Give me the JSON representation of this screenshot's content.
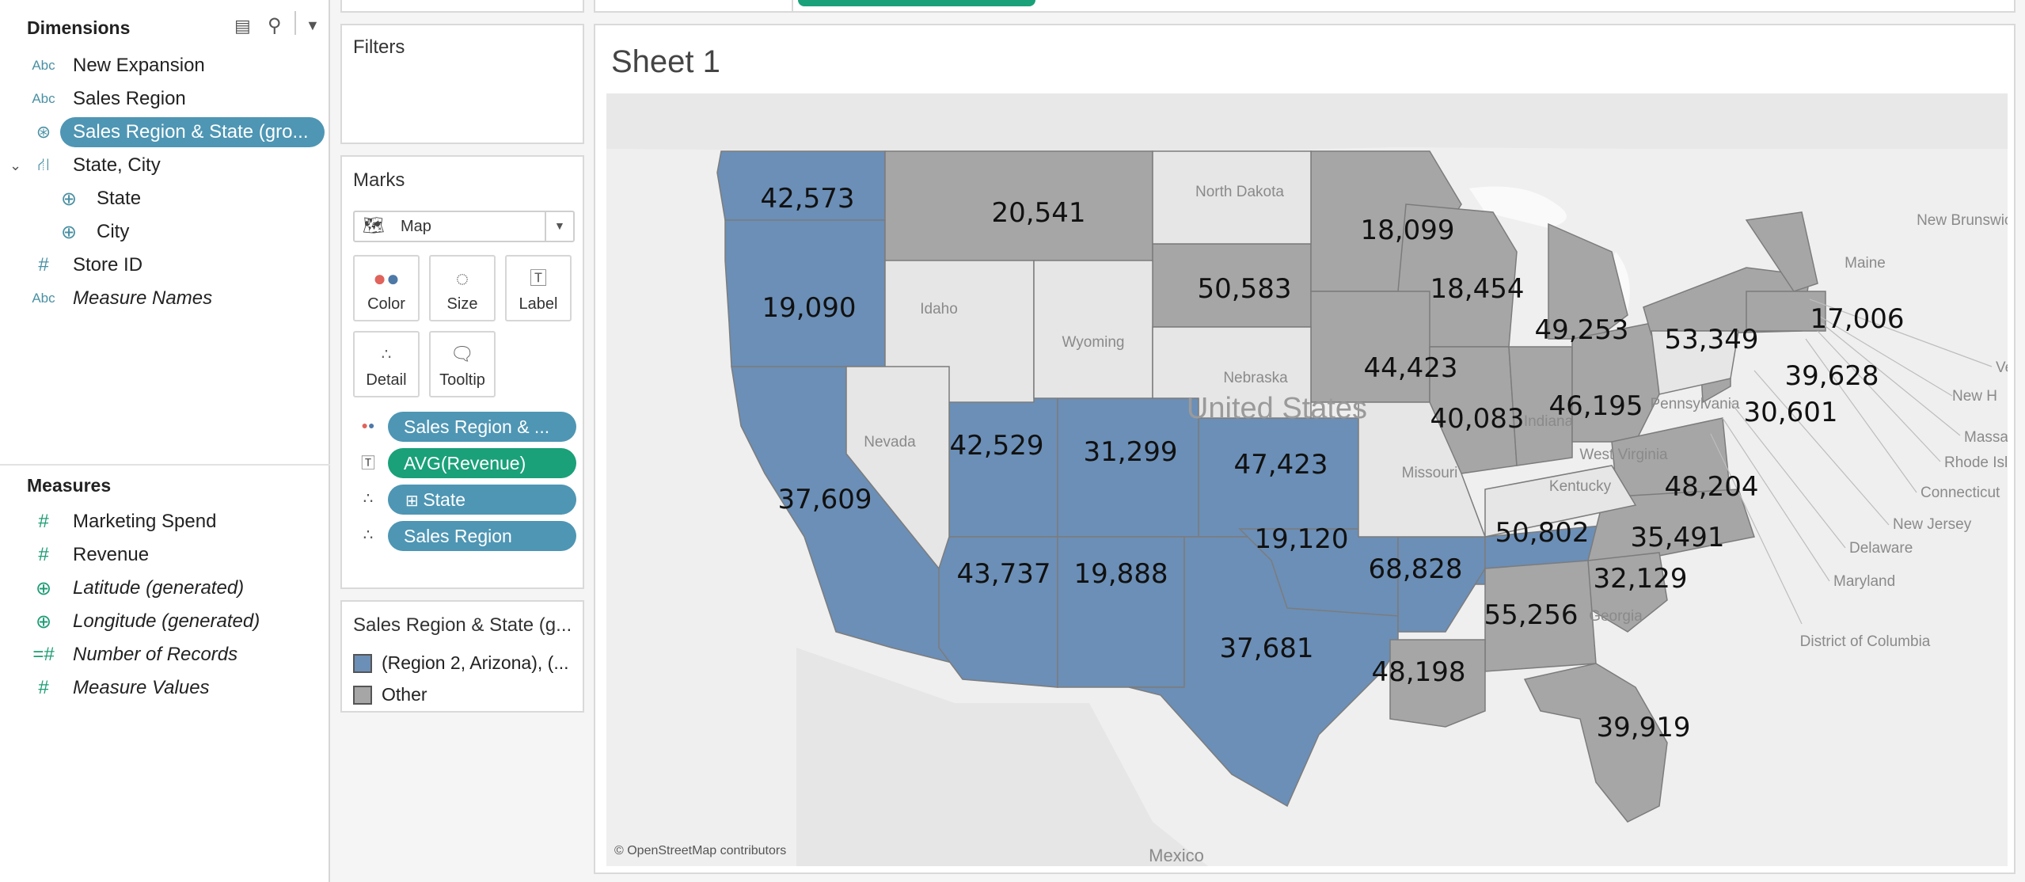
{
  "dimensions": {
    "title": "Dimensions",
    "fields": [
      {
        "icon": "Abc",
        "label": "New Expansion"
      },
      {
        "icon": "Abc",
        "label": "Sales Region"
      },
      {
        "icon": "Abc",
        "label": "Sales Region & State (gro..."
      },
      {
        "icon": "Abc",
        "label": "State, City"
      },
      {
        "icon": "Abc",
        "label": "State"
      },
      {
        "icon": "Abc",
        "label": "City"
      },
      {
        "icon": "Abc",
        "label": "Store ID"
      },
      {
        "icon": "Abc",
        "label": "Measure Names"
      }
    ]
  },
  "measures": {
    "title": "Measures",
    "fields": [
      {
        "label": "Marketing Spend"
      },
      {
        "label": "Revenue"
      },
      {
        "label": "Latitude (generated)"
      },
      {
        "label": "Longitude (generated)"
      },
      {
        "label": "Number of Records"
      },
      {
        "label": "Measure Values"
      }
    ]
  },
  "filters": {
    "title": "Filters"
  },
  "marks": {
    "title": "Marks",
    "type": "Map",
    "buttons": [
      "Color",
      "Size",
      "Label",
      "Detail",
      "Tooltip"
    ],
    "shelf": [
      {
        "label": "Sales Region & ...",
        "color": "#4e96b4"
      },
      {
        "label": "AVG(Revenue)",
        "color": "#1aa179"
      },
      {
        "label": "State",
        "color": "#4e96b4"
      },
      {
        "label": "Sales Region",
        "color": "#4e96b4"
      }
    ]
  },
  "legend": {
    "title": "Sales Region & State (g...",
    "items": [
      {
        "label": "(Region 2, Arizona), (...",
        "color": "#6b8fb7"
      },
      {
        "label": "Other",
        "color": "#a6a6a6"
      }
    ]
  },
  "sheet": {
    "title": "Sheet 1"
  },
  "map": {
    "credit": "© OpenStreetMap contributors",
    "colors": {
      "group": "#6b8fb7",
      "other": "#a6a6a6",
      "none": "#e8e8e8"
    },
    "values": {
      "washington": "42,573",
      "oregon": "19,090",
      "california": "37,609",
      "montana": "20,541",
      "south_dakota": "50,583",
      "minnesota": "18,099",
      "wisconsin": "18,454",
      "michigan": "49,253",
      "iowa": "44,423",
      "illinois": "40,083",
      "ohio": "46,195",
      "new_york": "53,349",
      "vermont_nh": "17,006",
      "massachusetts": "39,628",
      "new_jersey": "30,601",
      "utah": "42,529",
      "colorado": "31,299",
      "kansas": "47,423",
      "arizona": "43,737",
      "new_mexico": "19,888",
      "oklahoma": "19,120",
      "arkansas": "68,828",
      "tennessee": "50,802",
      "virginia": "48,204",
      "north_carolina": "35,491",
      "south_carolina": "32,129",
      "alabama_georgia": "55,256",
      "texas": "37,681",
      "louisiana": "48,198",
      "florida": "39,919"
    },
    "places": {
      "north_dakota": "North Dakota",
      "idaho": "Idaho",
      "wyoming": "Wyoming",
      "nebraska": "Nebraska",
      "nevada": "Nevada",
      "united_states": "United States",
      "missouri": "Missouri",
      "kentucky": "Kentucky",
      "west_virginia": "West Virginia",
      "pennsylvania": "Pennsylvania",
      "indiana": "Indiana",
      "georgia": "Georgia",
      "maine": "Maine",
      "new_brunswick": "New Brunswick",
      "vermont": "Ver",
      "new_hampshire": "New H",
      "massachusetts": "Massac",
      "rhode_island": "Rhode Isl",
      "connecticut": "Connecticut",
      "new_jersey": "New Jersey",
      "delaware": "Delaware",
      "maryland": "Maryland",
      "dc": "District of Columbia",
      "mexico": "Mexico"
    }
  }
}
